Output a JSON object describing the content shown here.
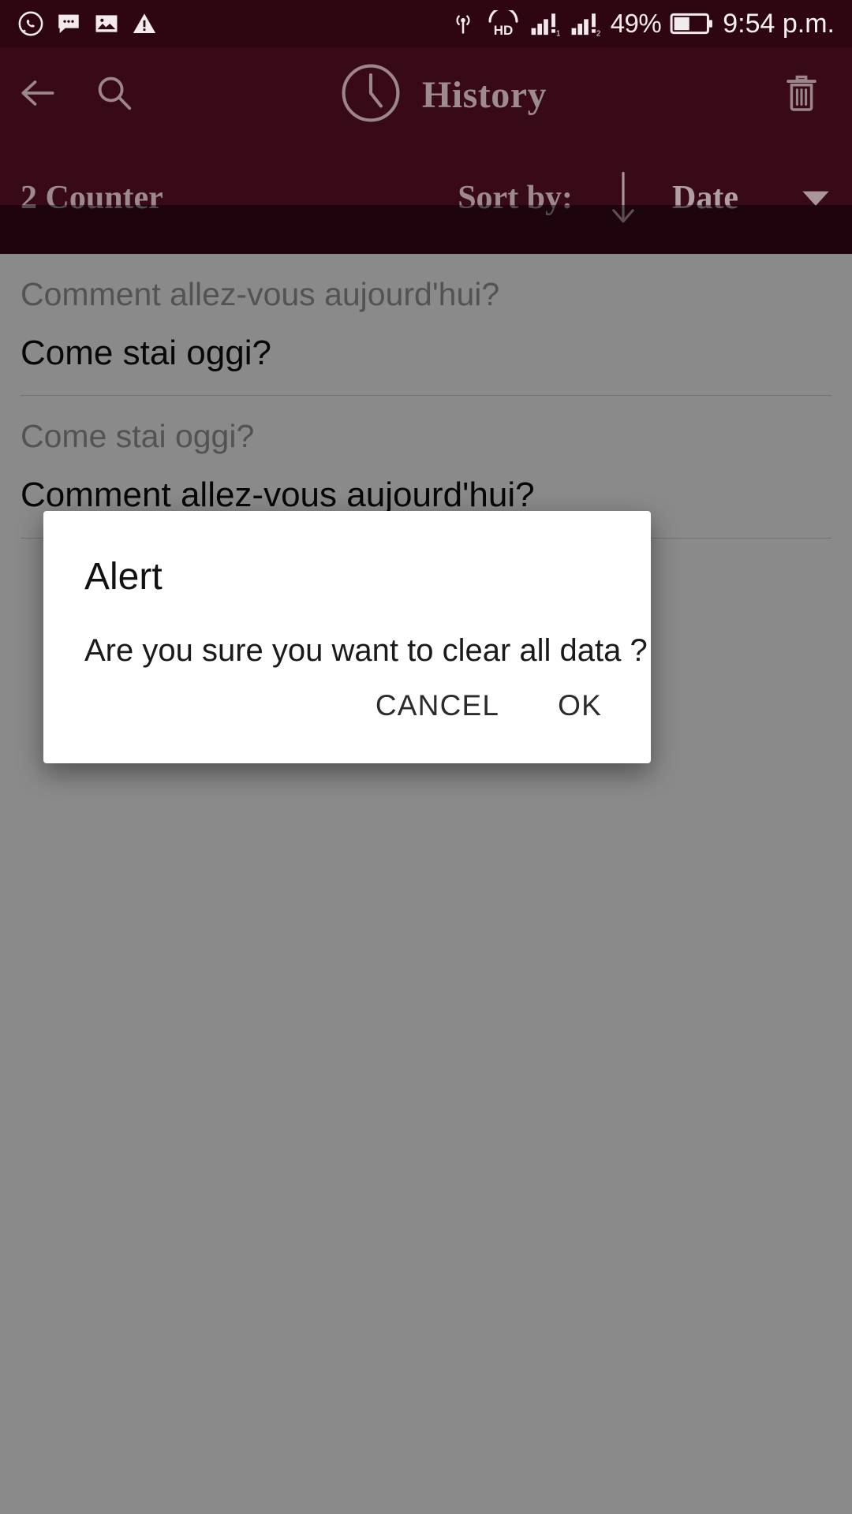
{
  "status_bar": {
    "left_icons": [
      {
        "name": "whatsapp-icon",
        "glyph": "whatsapp"
      },
      {
        "name": "message-icon",
        "glyph": "message"
      },
      {
        "name": "image-icon",
        "glyph": "image"
      },
      {
        "name": "warning-icon",
        "glyph": "warning"
      }
    ],
    "right_icons": [
      {
        "name": "hotspot-icon",
        "glyph": "hotspot"
      },
      {
        "name": "hd-voice-icon",
        "glyph": "hd"
      },
      {
        "name": "signal-sim1-icon",
        "glyph": "signal1"
      },
      {
        "name": "signal-sim2-icon",
        "glyph": "signal2"
      },
      {
        "name": "battery-icon",
        "glyph": "battery"
      }
    ],
    "battery_percent": "49%",
    "time": "9:54 p.m."
  },
  "app_bar": {
    "back_icon": "arrow-left-icon",
    "search_icon": "search-icon",
    "clock_icon": "clock-icon",
    "title": "History",
    "delete_icon": "trash-icon"
  },
  "sort_row": {
    "counter_label": "2 Counter",
    "sort_by_label": "Sort by:",
    "sort_direction_icon": "arrow-down-icon",
    "sort_field": "Date",
    "caret_icon": "chevron-down-icon"
  },
  "history": {
    "items": [
      {
        "source": "Comment allez-vous aujourd'hui?",
        "target": "Come stai oggi?"
      },
      {
        "source": "Come stai oggi?",
        "target": "Comment allez-vous aujourd'hui?"
      }
    ]
  },
  "dialog": {
    "title": "Alert",
    "message": "Are you sure you want to clear all data ?",
    "cancel_label": "CANCEL",
    "ok_label": "OK"
  },
  "colors": {
    "status_bar_bg": "#2e0612",
    "app_bar_bg": "#380a18",
    "app_bar_text": "#9e8b90",
    "content_bg": "#ffffff",
    "scrim": "rgba(0,0,0,0.46)",
    "dialog_bg": "#ffffff",
    "source_text": "#9a9a9a",
    "target_text": "#0d0d0d"
  }
}
